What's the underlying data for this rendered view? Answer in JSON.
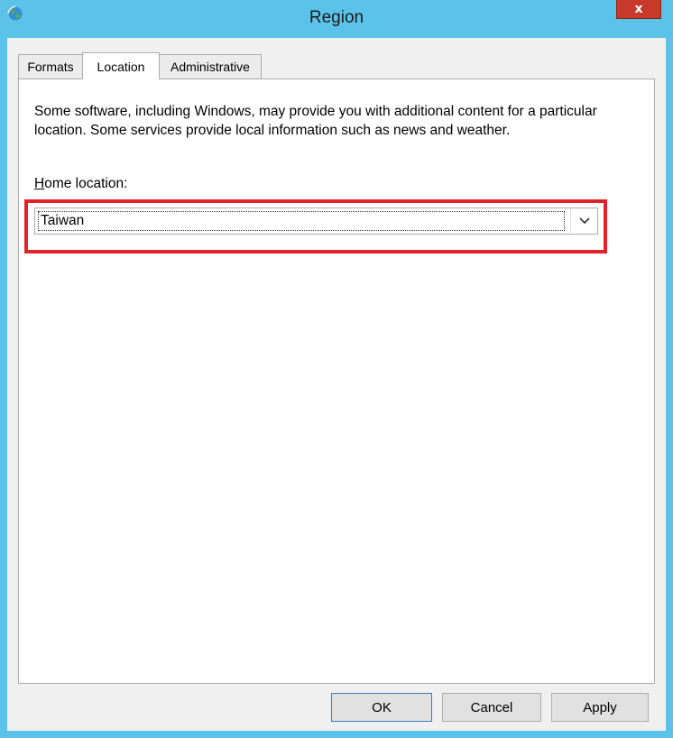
{
  "window": {
    "title": "Region",
    "close_label": "x"
  },
  "tabs": [
    {
      "label": "Formats"
    },
    {
      "label": "Location"
    },
    {
      "label": "Administrative"
    }
  ],
  "location": {
    "description": "Some software, including Windows, may provide you with additional content for a particular location. Some services provide local information such as news and weather.",
    "home_location_label": "Home location:",
    "home_location_value": "Taiwan"
  },
  "buttons": {
    "ok": "OK",
    "cancel": "Cancel",
    "apply": "Apply"
  },
  "colors": {
    "titlebar": "#5bc3ea",
    "close": "#c7392a",
    "highlight": "#e0222b"
  }
}
